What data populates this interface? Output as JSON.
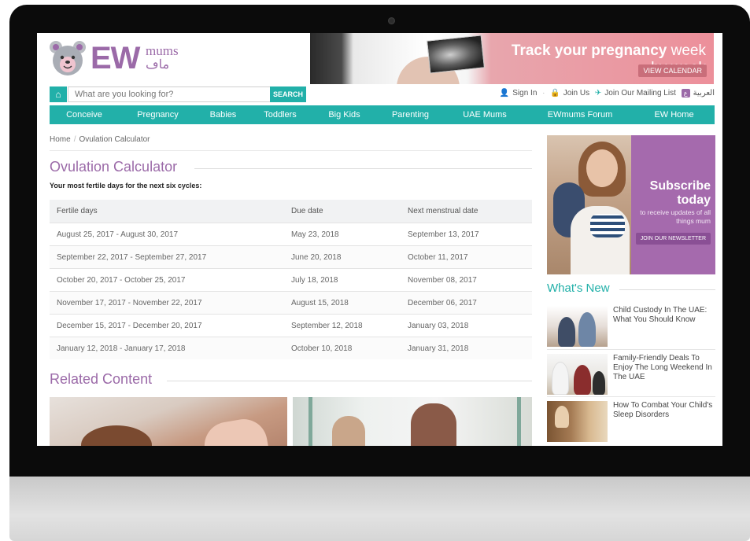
{
  "brand": {
    "logo_main": "EW",
    "logo_sub": "mums",
    "logo_arabic": "ماڡ"
  },
  "banner": {
    "line1_bold": "Track your pregnancy",
    "line1_light": " week",
    "line2": "by week",
    "button": "VIEW CALENDAR"
  },
  "search": {
    "placeholder": "What are you looking for?",
    "button": "SEARCH"
  },
  "toplinks": {
    "sign_in": "Sign In",
    "join_us": "Join Us",
    "mailing_list": "Join Our Mailing List",
    "arabic": "العربية"
  },
  "nav": [
    {
      "label": "Conceive",
      "w": 88
    },
    {
      "label": "Pregnancy",
      "w": 99
    },
    {
      "label": "Babies",
      "w": 67
    },
    {
      "label": "Toddlers",
      "w": 78
    },
    {
      "label": "Big Kids",
      "w": 85
    },
    {
      "label": "Parenting",
      "w": 83
    },
    {
      "label": "UAE Mums",
      "w": 106
    },
    {
      "label": "EWmums Forum",
      "w": 136
    },
    {
      "label": "EW Home",
      "w": 103
    }
  ],
  "breadcrumb": {
    "home": "Home",
    "current": "Ovulation Calculator"
  },
  "main": {
    "title": "Ovulation Calculator",
    "intro": "Your most fertile days for the next six cycles:",
    "related_title": "Related Content"
  },
  "table": {
    "headers": [
      "Fertile days",
      "Due date",
      "Next menstrual date"
    ],
    "rows": [
      [
        "August 25, 2017 - August 30, 2017",
        "May 23, 2018",
        "September 13, 2017"
      ],
      [
        "September 22, 2017 - September 27, 2017",
        "June 20, 2018",
        "October 11, 2017"
      ],
      [
        "October 20, 2017 - October 25, 2017",
        "July 18, 2018",
        "November 08, 2017"
      ],
      [
        "November 17, 2017 - November 22, 2017",
        "August 15, 2018",
        "December 06, 2017"
      ],
      [
        "December 15, 2017 - December 20, 2017",
        "September 12, 2018",
        "January 03, 2018"
      ],
      [
        "January 12, 2018 - January 17, 2018",
        "October 10, 2018",
        "January 31, 2018"
      ]
    ]
  },
  "sidebar": {
    "subscribe_title": "Subscribe today",
    "subscribe_text": "to receive updates of all things mum",
    "subscribe_button": "JOIN OUR NEWSLETTER",
    "whats_new": "What's New",
    "news": [
      "Child Custody In The UAE: What You Should Know",
      "Family-Friendly Deals To Enjoy The Long Weekend In The UAE",
      "How To Combat Your Child's Sleep Disorders"
    ]
  },
  "colors": {
    "teal": "#22b0a9",
    "purple": "#9b6aa8",
    "banner_pink": "#ec8f9a"
  }
}
